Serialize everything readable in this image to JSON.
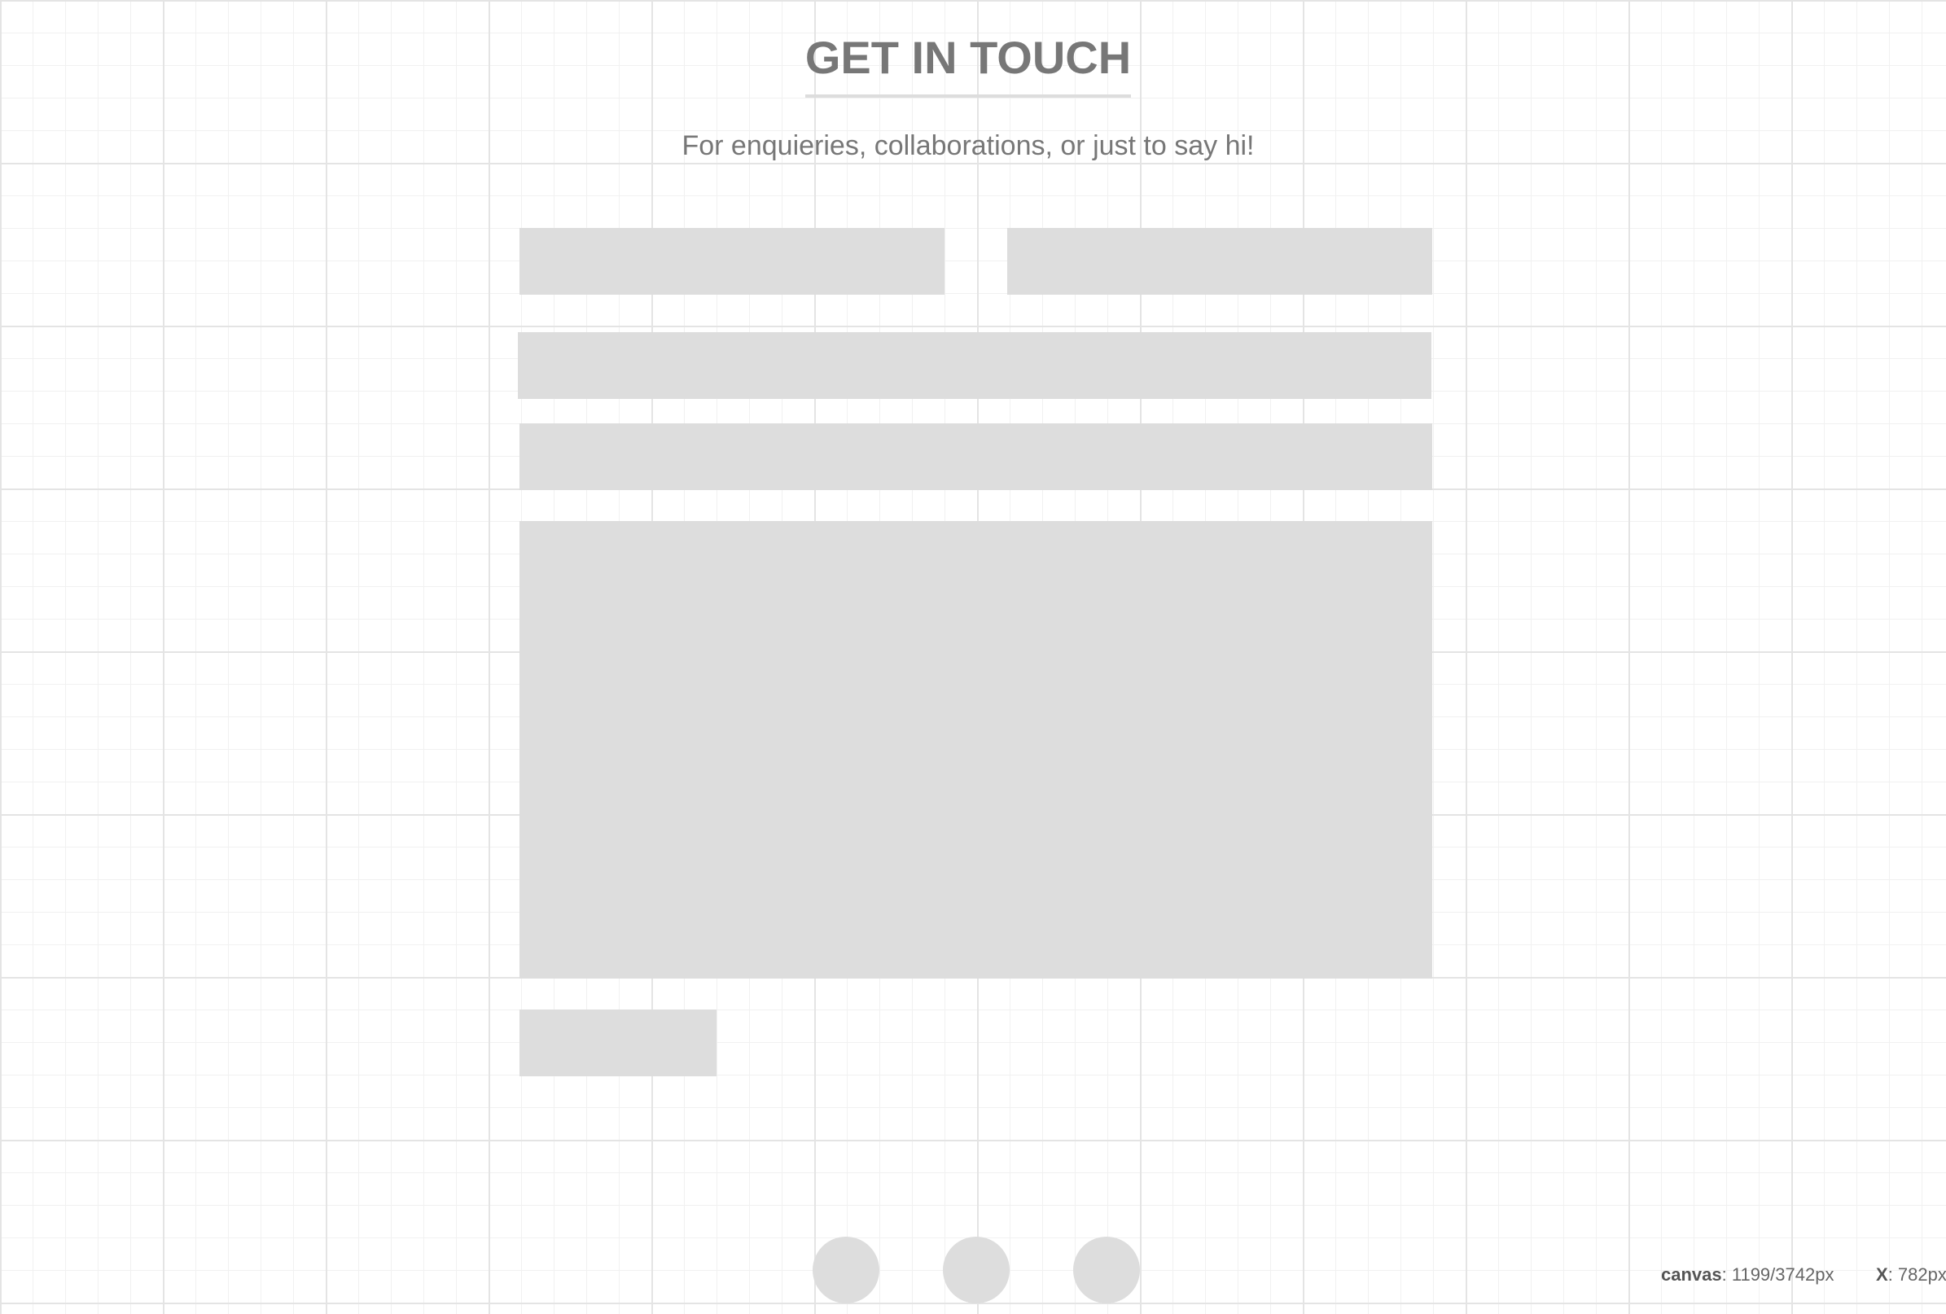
{
  "header": {
    "title": "GET IN TOUCH",
    "subtitle": "For enquieries, collaborations, or just to say hi!"
  },
  "form": {
    "name_placeholder": "",
    "email_placeholder": "",
    "subject_placeholder": "",
    "phone_placeholder": "",
    "message_placeholder": "",
    "submit_label": ""
  },
  "social": [
    {
      "icon": "social-icon"
    },
    {
      "icon": "social-icon"
    },
    {
      "icon": "social-icon"
    }
  ],
  "status": {
    "canvas_label": "canvas",
    "canvas_value": ": 1199/3742px",
    "x_label": "X",
    "x_value": ": 782px"
  },
  "colors": {
    "background": "#ffffff",
    "grid": "#e4e4e4",
    "placeholder_block": "#dddddd",
    "text": "#777777"
  }
}
